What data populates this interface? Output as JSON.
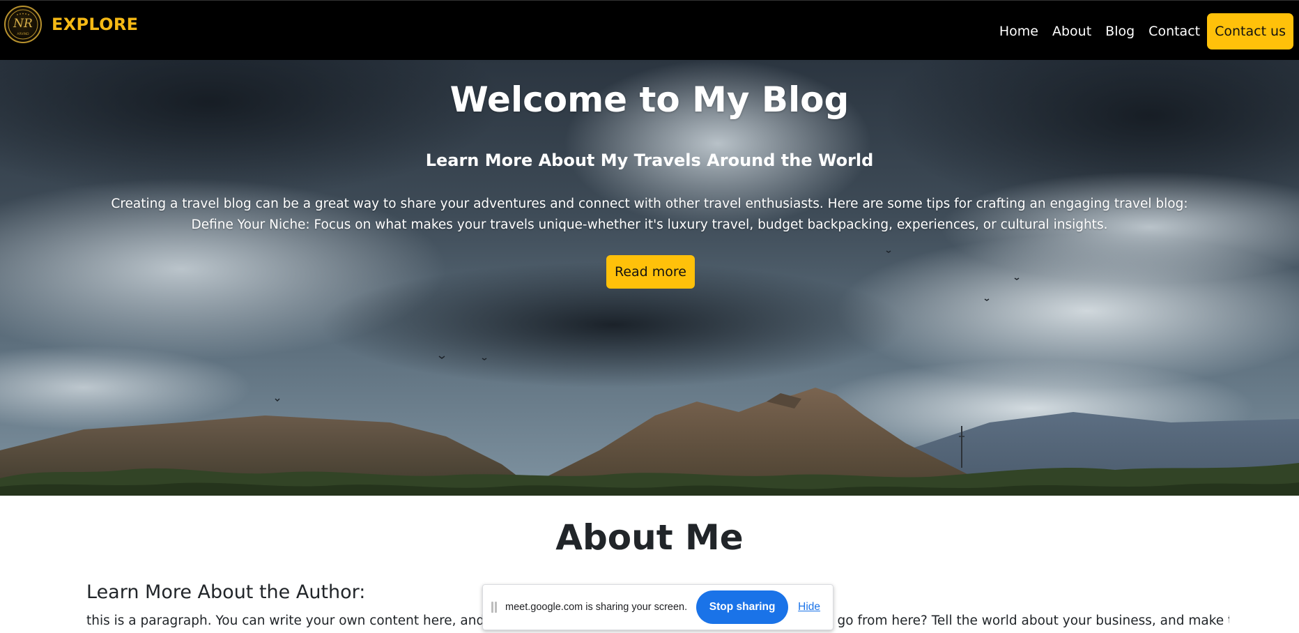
{
  "nav": {
    "brand": "EXPLORE",
    "logo_text": "NR",
    "logo_caption": "ARVIND",
    "links": [
      {
        "label": "Home"
      },
      {
        "label": "About"
      },
      {
        "label": "Blog"
      },
      {
        "label": "Contact"
      }
    ],
    "cta_label": "Contact us"
  },
  "hero": {
    "title": "Welcome to My Blog",
    "subtitle": "Learn More About My Travels Around the World",
    "text": "Creating a travel blog can be a great way to share your adventures and connect with other travel enthusiasts. Here are some tips for crafting an engaging travel blog: Define Your Niche: Focus on what makes your travels unique-whether it's luxury travel, budget backpacking, experiences, or cultural insights.",
    "button_label": "Read more"
  },
  "about": {
    "title": "About Me",
    "subtitle": "Learn More About the Author:",
    "text": "this is a paragraph. You can write your own content here, and fill in the blanks. What's your story and where do you go from here? Tell the world about your business, and make this"
  },
  "screen_share": {
    "message": "meet.google.com is sharing your screen.",
    "stop_label": "Stop sharing",
    "hide_label": "Hide"
  },
  "colors": {
    "accent": "#ffc10a",
    "brand": "#f5b915",
    "navbar": "#000000",
    "share_button": "#1a73e8"
  }
}
